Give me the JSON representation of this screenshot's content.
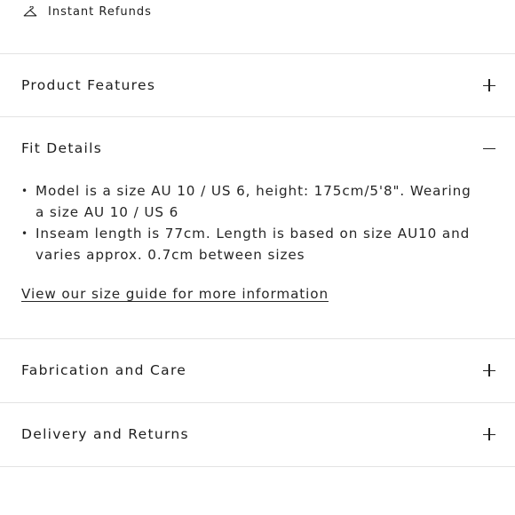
{
  "refund": {
    "icon": "hanger-icon",
    "label": "Instant Refunds"
  },
  "accordion": [
    {
      "title": "Product Features",
      "state": "collapsed",
      "toggle_icon": "plus-icon"
    },
    {
      "title": "Fit Details",
      "state": "expanded",
      "toggle_icon": "minus-icon"
    },
    {
      "title": "Fabrication and Care",
      "state": "collapsed",
      "toggle_icon": "plus-icon"
    },
    {
      "title": "Delivery and Returns",
      "state": "collapsed",
      "toggle_icon": "plus-icon"
    }
  ],
  "fit_details": {
    "bullets": [
      "Model is a size AU 10 / US 6, height: 175cm/5'8\". Wearing a size AU 10 / US 6",
      "Inseam length is 77cm. Length is based on size AU10 and varies approx. 0.7cm between sizes"
    ],
    "size_guide_link": "View our size guide for more information"
  },
  "colors": {
    "text": "#1d1d1d",
    "divider": "#e3e3e3",
    "background": "#ffffff"
  }
}
